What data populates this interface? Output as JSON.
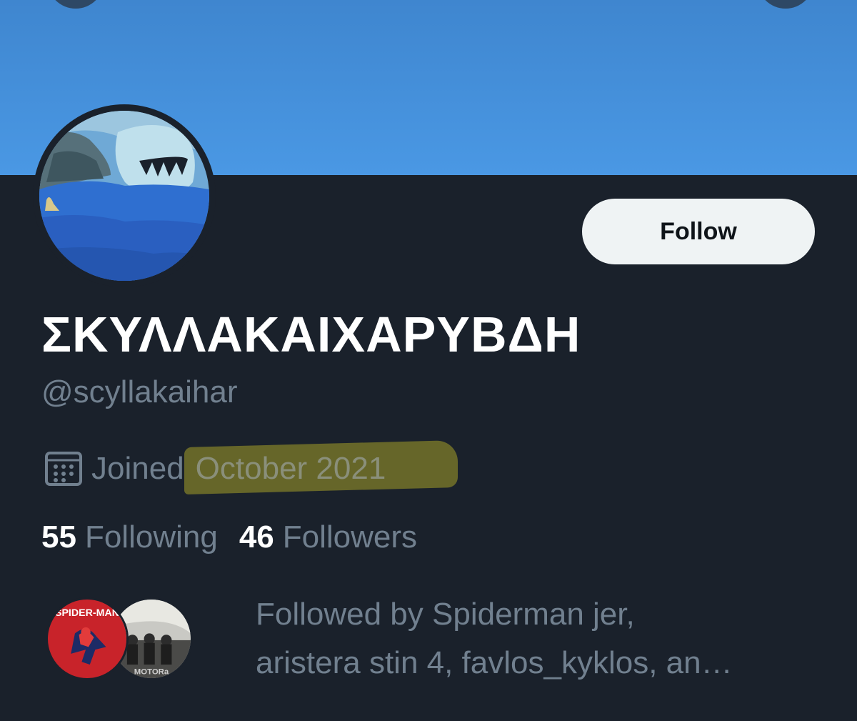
{
  "profile": {
    "display_name": "ΣΚΥΛΛΑΚΑΙΧΑΡΥΒΔΗ",
    "handle": "@scyllakaihar",
    "joined_label": "Joined",
    "joined_date": "October 2021",
    "follow_button": "Follow"
  },
  "stats": {
    "following_count": "55",
    "following_label": "Following",
    "followers_count": "46",
    "followers_label": "Followers"
  },
  "mutuals": {
    "line1": "Followed by Spiderman jer,",
    "line2": "aristera stin 4, favlos_kyklos, an…",
    "avatar1_text": "SPIDER-MAN",
    "avatar2_text": "MOTORa"
  },
  "icons": {
    "calendar": "calendar-icon"
  },
  "colors": {
    "banner": "#4a98e4",
    "background": "#1a212b",
    "secondary_text": "#71808f",
    "follow_button_bg": "#eff3f4",
    "highlight": "#a5a028"
  }
}
